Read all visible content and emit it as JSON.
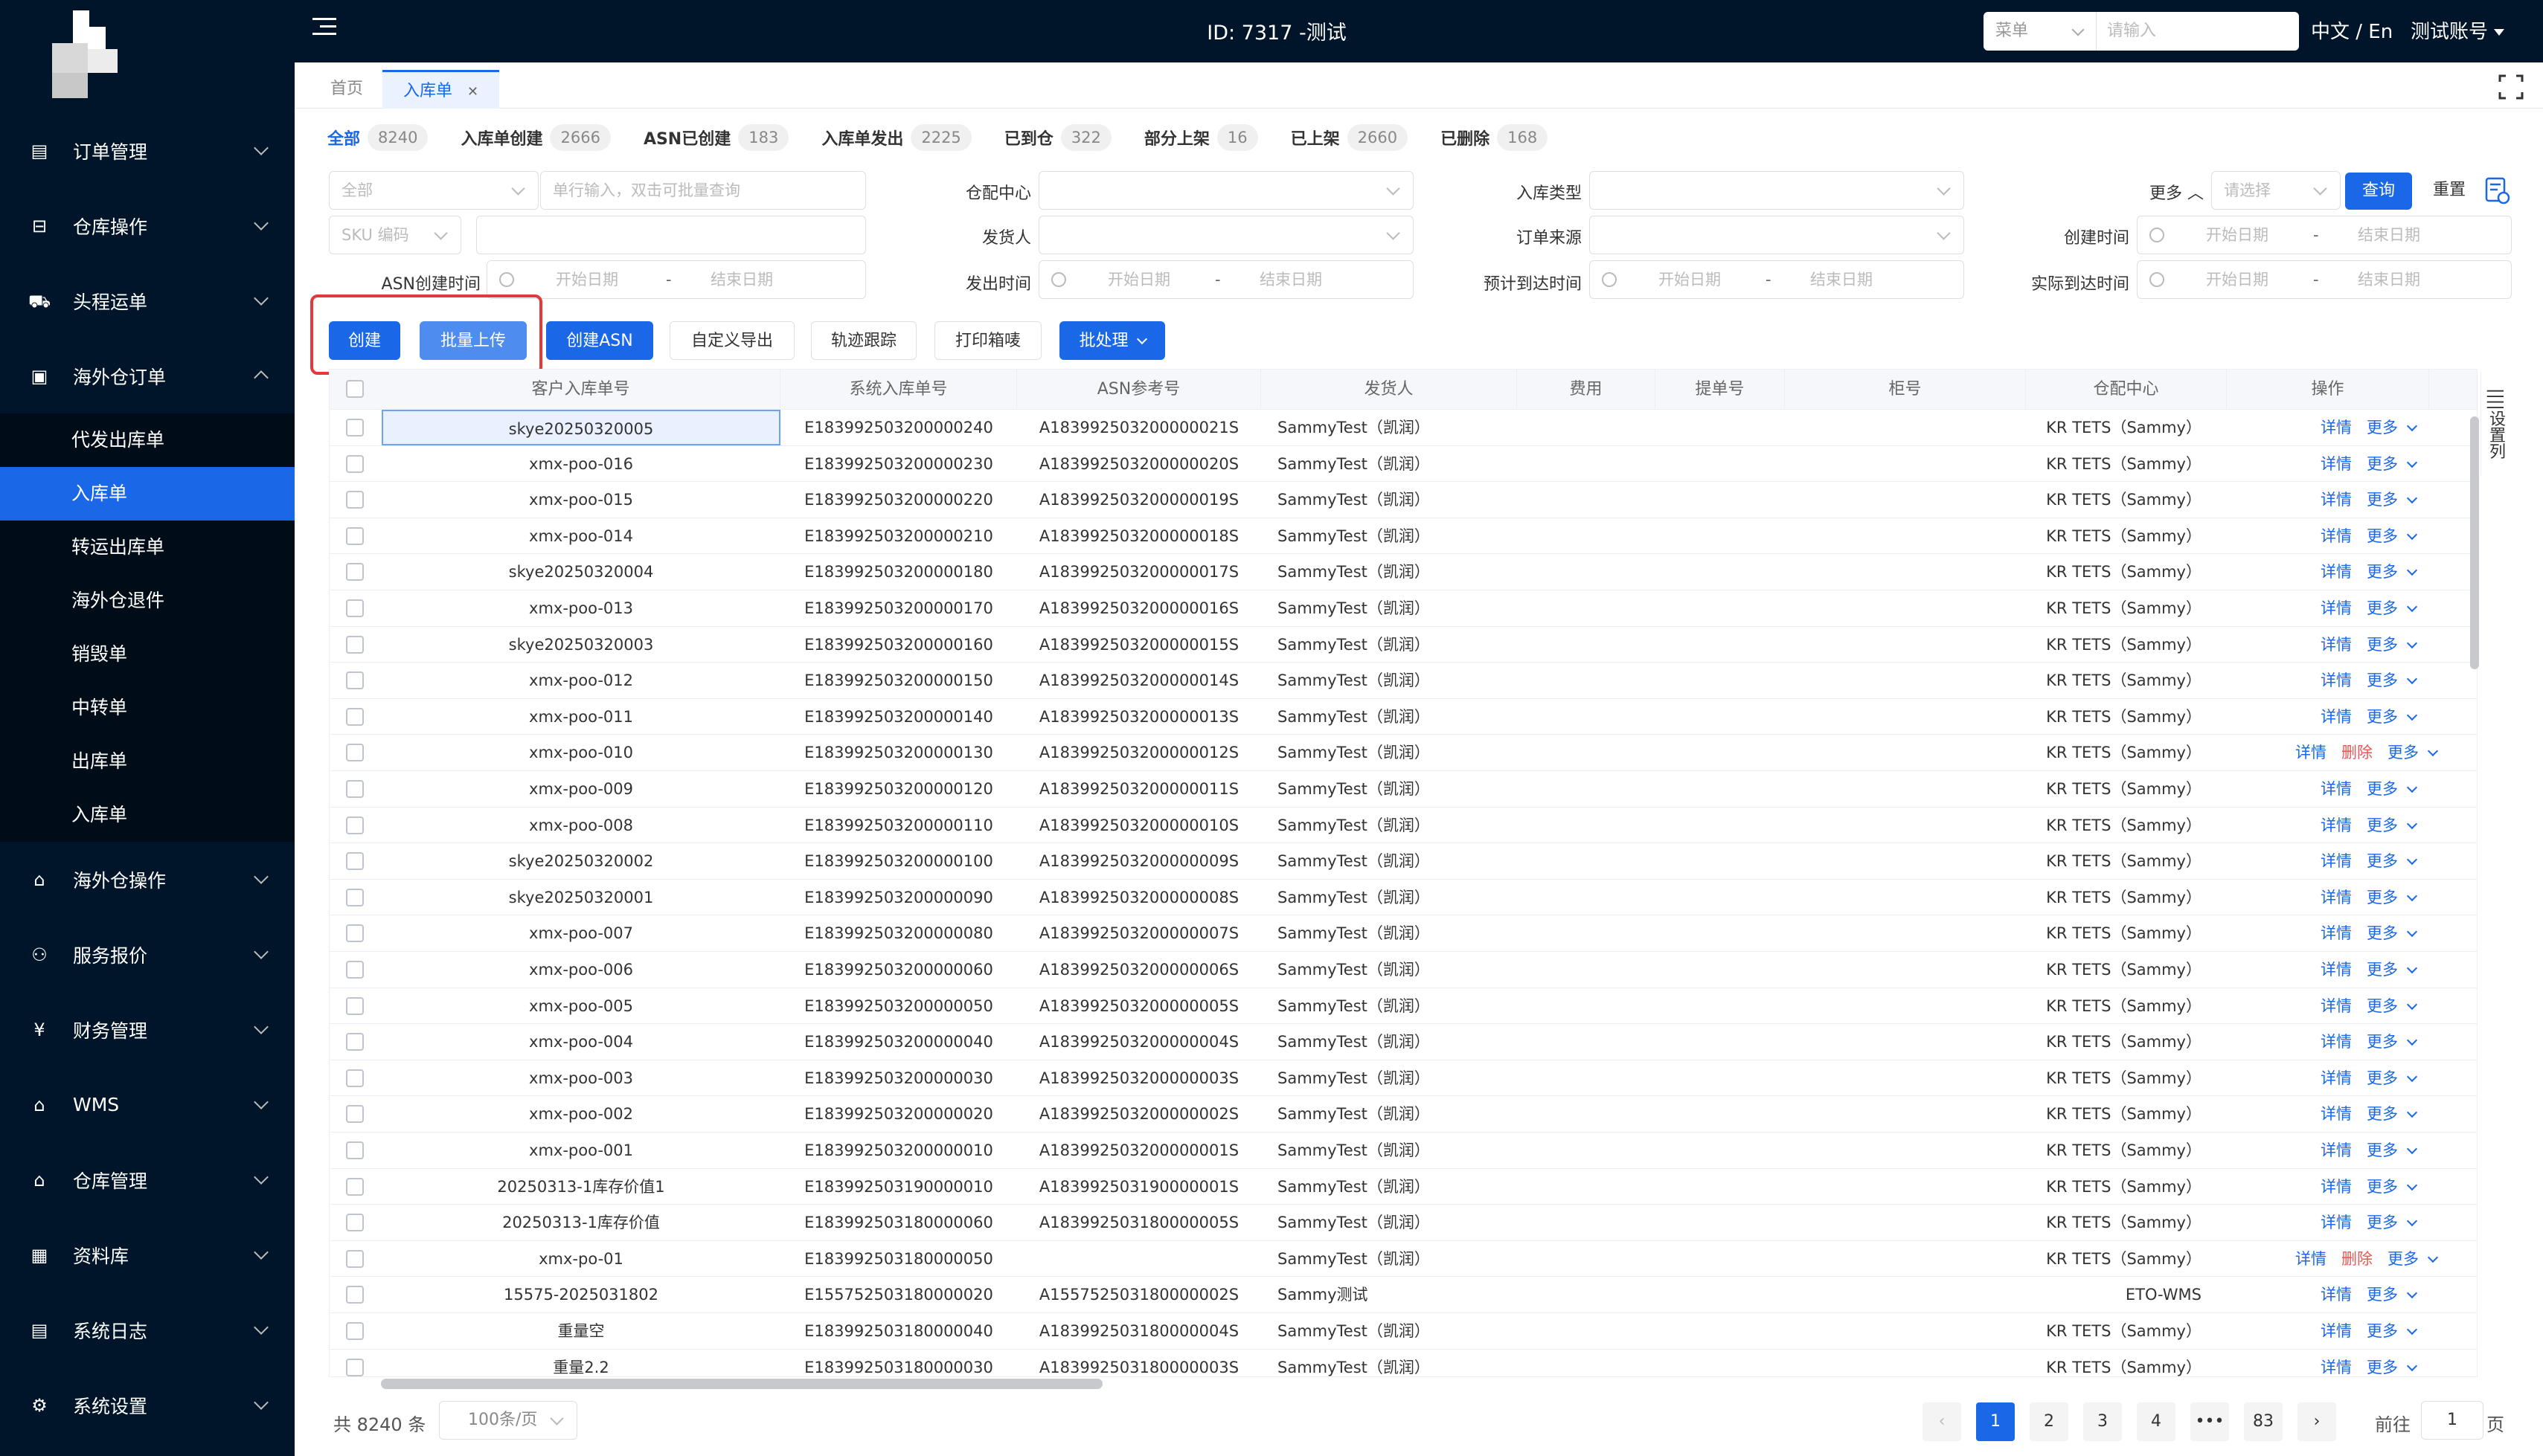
{
  "header": {
    "title": "ID: 7317 -测试",
    "search_type": "菜单",
    "search_placeholder": "请输入",
    "lang": "中文 / En",
    "account": "测试账号"
  },
  "sidebar": {
    "items": [
      {
        "label": "订单管理",
        "icon": "order-icon"
      },
      {
        "label": "仓库操作",
        "icon": "warehouse-ops-icon"
      },
      {
        "label": "头程运单",
        "icon": "shipping-icon"
      },
      {
        "label": "海外仓订单",
        "icon": "overseas-order-icon"
      },
      {
        "label": "海外仓操作",
        "icon": "overseas-ops-icon"
      },
      {
        "label": "服务报价",
        "icon": "quote-icon"
      },
      {
        "label": "财务管理",
        "icon": "finance-icon"
      },
      {
        "label": "WMS",
        "icon": "wms-icon"
      },
      {
        "label": "仓库管理",
        "icon": "warehouse-mgmt-icon"
      },
      {
        "label": "资料库",
        "icon": "database-icon"
      },
      {
        "label": "系统日志",
        "icon": "log-icon"
      },
      {
        "label": "系统设置",
        "icon": "settings-icon"
      }
    ],
    "subitems": [
      "代发出库单",
      "入库单",
      "转运出库单",
      "海外仓退件",
      "销毁单",
      "中转单",
      "出库单",
      "入库单"
    ]
  },
  "tabs": [
    {
      "label": "首页"
    },
    {
      "label": "入库单"
    }
  ],
  "stats": [
    {
      "label": "全部",
      "count": "8240"
    },
    {
      "label": "入库单创建",
      "count": "2666"
    },
    {
      "label": "ASN已创建",
      "count": "183"
    },
    {
      "label": "入库单发出",
      "count": "2225"
    },
    {
      "label": "已到仓",
      "count": "322"
    },
    {
      "label": "部分上架",
      "count": "16"
    },
    {
      "label": "已上架",
      "count": "2660"
    },
    {
      "label": "已删除",
      "count": "168"
    }
  ],
  "filters": {
    "scope": "全部",
    "order_placeholder": "单行输入，双击可批量查询",
    "sku": "SKU 编码",
    "asn_time_label": "ASN创建时间",
    "start_date": "开始日期",
    "end_date": "结束日期",
    "dash": "-",
    "warehouse_label": "仓配中心",
    "shipper_label": "发货人",
    "ship_time_label": "发出时间",
    "type_label": "入库类型",
    "source_label": "订单来源",
    "eta_label": "预计到达时间",
    "more_label": "更多",
    "more_placeholder": "请选择",
    "query": "查询",
    "reset": "重置",
    "created_label": "创建时间",
    "arrival_label": "实际到达时间"
  },
  "actions": {
    "create": "创建",
    "batch_upload": "批量上传",
    "create_asn": "创建ASN",
    "custom_export": "自定义导出",
    "track": "轨迹跟踪",
    "print": "打印箱唛",
    "batch": "批处理"
  },
  "table": {
    "columns": [
      "客户入库单号",
      "系统入库单号",
      "ASN参考号",
      "发货人",
      "费用",
      "提单号",
      "柜号",
      "仓配中心",
      "操作"
    ],
    "detail": "详情",
    "delete": "删除",
    "more": "更多",
    "rows": [
      {
        "c": "skye20250320005",
        "s": "E183992503200000240",
        "a": "A183992503200000021S",
        "sh": "SammyTest（凯润）",
        "w": "KR TETS（Sammy）",
        "del": false
      },
      {
        "c": "xmx-poo-016",
        "s": "E183992503200000230",
        "a": "A183992503200000020S",
        "sh": "SammyTest（凯润）",
        "w": "KR TETS（Sammy）",
        "del": false
      },
      {
        "c": "xmx-poo-015",
        "s": "E183992503200000220",
        "a": "A183992503200000019S",
        "sh": "SammyTest（凯润）",
        "w": "KR TETS（Sammy）",
        "del": false
      },
      {
        "c": "xmx-poo-014",
        "s": "E183992503200000210",
        "a": "A183992503200000018S",
        "sh": "SammyTest（凯润）",
        "w": "KR TETS（Sammy）",
        "del": false
      },
      {
        "c": "skye20250320004",
        "s": "E183992503200000180",
        "a": "A183992503200000017S",
        "sh": "SammyTest（凯润）",
        "w": "KR TETS（Sammy）",
        "del": false
      },
      {
        "c": "xmx-poo-013",
        "s": "E183992503200000170",
        "a": "A183992503200000016S",
        "sh": "SammyTest（凯润）",
        "w": "KR TETS（Sammy）",
        "del": false
      },
      {
        "c": "skye20250320003",
        "s": "E183992503200000160",
        "a": "A183992503200000015S",
        "sh": "SammyTest（凯润）",
        "w": "KR TETS（Sammy）",
        "del": false
      },
      {
        "c": "xmx-poo-012",
        "s": "E183992503200000150",
        "a": "A183992503200000014S",
        "sh": "SammyTest（凯润）",
        "w": "KR TETS（Sammy）",
        "del": false
      },
      {
        "c": "xmx-poo-011",
        "s": "E183992503200000140",
        "a": "A183992503200000013S",
        "sh": "SammyTest（凯润）",
        "w": "KR TETS（Sammy）",
        "del": false
      },
      {
        "c": "xmx-poo-010",
        "s": "E183992503200000130",
        "a": "A183992503200000012S",
        "sh": "SammyTest（凯润）",
        "w": "KR TETS（Sammy）",
        "del": true
      },
      {
        "c": "xmx-poo-009",
        "s": "E183992503200000120",
        "a": "A183992503200000011S",
        "sh": "SammyTest（凯润）",
        "w": "KR TETS（Sammy）",
        "del": false
      },
      {
        "c": "xmx-poo-008",
        "s": "E183992503200000110",
        "a": "A183992503200000010S",
        "sh": "SammyTest（凯润）",
        "w": "KR TETS（Sammy）",
        "del": false
      },
      {
        "c": "skye20250320002",
        "s": "E183992503200000100",
        "a": "A183992503200000009S",
        "sh": "SammyTest（凯润）",
        "w": "KR TETS（Sammy）",
        "del": false
      },
      {
        "c": "skye20250320001",
        "s": "E183992503200000090",
        "a": "A183992503200000008S",
        "sh": "SammyTest（凯润）",
        "w": "KR TETS（Sammy）",
        "del": false
      },
      {
        "c": "xmx-poo-007",
        "s": "E183992503200000080",
        "a": "A183992503200000007S",
        "sh": "SammyTest（凯润）",
        "w": "KR TETS（Sammy）",
        "del": false
      },
      {
        "c": "xmx-poo-006",
        "s": "E183992503200000060",
        "a": "A183992503200000006S",
        "sh": "SammyTest（凯润）",
        "w": "KR TETS（Sammy）",
        "del": false
      },
      {
        "c": "xmx-poo-005",
        "s": "E183992503200000050",
        "a": "A183992503200000005S",
        "sh": "SammyTest（凯润）",
        "w": "KR TETS（Sammy）",
        "del": false
      },
      {
        "c": "xmx-poo-004",
        "s": "E183992503200000040",
        "a": "A183992503200000004S",
        "sh": "SammyTest（凯润）",
        "w": "KR TETS（Sammy）",
        "del": false
      },
      {
        "c": "xmx-poo-003",
        "s": "E183992503200000030",
        "a": "A183992503200000003S",
        "sh": "SammyTest（凯润）",
        "w": "KR TETS（Sammy）",
        "del": false
      },
      {
        "c": "xmx-poo-002",
        "s": "E183992503200000020",
        "a": "A183992503200000002S",
        "sh": "SammyTest（凯润）",
        "w": "KR TETS（Sammy）",
        "del": false
      },
      {
        "c": "xmx-poo-001",
        "s": "E183992503200000010",
        "a": "A183992503200000001S",
        "sh": "SammyTest（凯润）",
        "w": "KR TETS（Sammy）",
        "del": false
      },
      {
        "c": "20250313-1库存价值1",
        "s": "E183992503190000010",
        "a": "A183992503190000001S",
        "sh": "SammyTest（凯润）",
        "w": "KR TETS（Sammy）",
        "del": false
      },
      {
        "c": "20250313-1库存价值",
        "s": "E183992503180000060",
        "a": "A183992503180000005S",
        "sh": "SammyTest（凯润）",
        "w": "KR TETS（Sammy）",
        "del": false
      },
      {
        "c": "xmx-po-01",
        "s": "E183992503180000050",
        "a": "",
        "sh": "SammyTest（凯润）",
        "w": "KR TETS（Sammy）",
        "del": true
      },
      {
        "c": "15575-2025031802",
        "s": "E155752503180000020",
        "a": "A155752503180000002S",
        "sh": "Sammy测试",
        "w": "ETO-WMS",
        "del": false
      },
      {
        "c": "重量空",
        "s": "E183992503180000040",
        "a": "A183992503180000004S",
        "sh": "SammyTest（凯润）",
        "w": "KR TETS（Sammy）",
        "del": false
      },
      {
        "c": "重量2.2",
        "s": "E183992503180000030",
        "a": "A183992503180000003S",
        "sh": "SammyTest（凯润）",
        "w": "KR TETS（Sammy）",
        "del": false
      }
    ]
  },
  "settings_col": "设置列",
  "pagination": {
    "total": "共 8240 条",
    "page_size": "100条/页",
    "pages": [
      "1",
      "2",
      "3",
      "4",
      "•••",
      "83"
    ],
    "goto": "前往",
    "goto_value": "1",
    "page_unit": "页"
  }
}
